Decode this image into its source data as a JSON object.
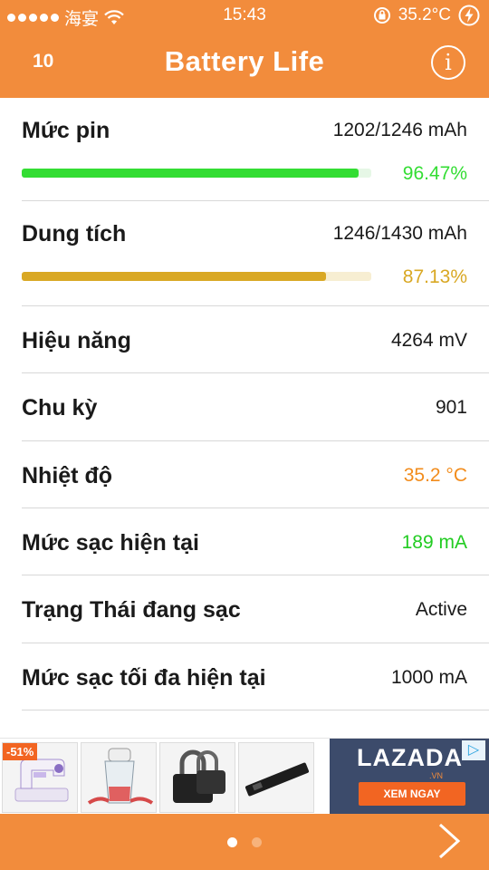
{
  "status_bar": {
    "carrier": "海宴",
    "time": "15:43",
    "temperature": "35.2°C",
    "icons": [
      "signal-dots-icon",
      "wifi-icon",
      "rotation-lock-icon",
      "charging-bolt-icon"
    ]
  },
  "nav": {
    "badge": "10",
    "title": "Battery Life",
    "info_label": "i"
  },
  "rows": {
    "battery_level": {
      "label": "Mức pin",
      "value": "1202/1246 mAh",
      "percent_text": "96.47%",
      "fraction": 0.9647,
      "color": "#33dd33",
      "track_color": "#e6f7e6"
    },
    "capacity": {
      "label": "Dung tích",
      "value": "1246/1430 mAh",
      "percent_text": "87.13%",
      "fraction": 0.8713,
      "color": "#d9a824",
      "track_color": "#f7eed2"
    },
    "voltage": {
      "label": "Hiệu năng",
      "value": "4264 mV"
    },
    "cycles": {
      "label": "Chu kỳ",
      "value": "901"
    },
    "temperature": {
      "label": "Nhiệt độ",
      "value": "35.2 °C",
      "color": "#f28c1c"
    },
    "charge_current": {
      "label": "Mức sạc hiện tại",
      "value": "189 mA",
      "color": "#22cc22"
    },
    "charging_state": {
      "label": "Trạng Thái đang sạc",
      "value": "Active"
    },
    "max_charge": {
      "label": "Mức sạc tối đa hiện tại",
      "value": "1000 mA"
    }
  },
  "ad": {
    "discount_badge": "-51%",
    "brand": "LAZADA",
    "brand_domain": ".VN",
    "cta": "XEM NGAY",
    "products": [
      "sewing-machine-icon",
      "food-chopper-icon",
      "padlock-icon",
      "laptop-battery-icon"
    ]
  },
  "bottom": {
    "pages": 2,
    "active_page": 1,
    "dot_active_color": "#ffffff",
    "dot_inactive_color": "#f7b37c",
    "next_icon": "chevron-right-icon"
  },
  "colors": {
    "brand": "#f28c3c"
  }
}
